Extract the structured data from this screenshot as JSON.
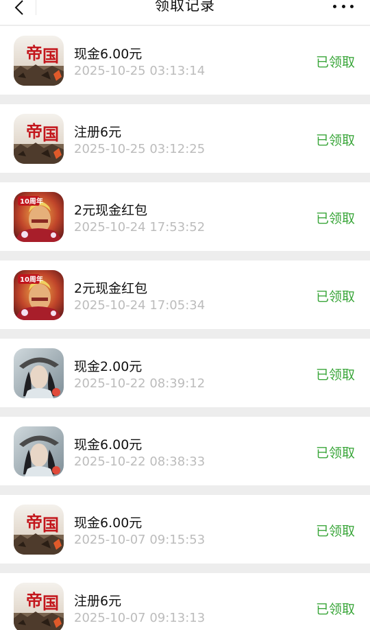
{
  "header": {
    "title": "领取记录"
  },
  "records": [
    {
      "icon": "empire-game-icon",
      "name": "现金6.00元",
      "time": "2025-10-25 03:13:14",
      "status": "已领取"
    },
    {
      "icon": "empire-game-icon",
      "name": "注册6元",
      "time": "2025-10-25 03:12:25",
      "status": "已领取"
    },
    {
      "icon": "hero-anniversary-game-icon",
      "name": "2元现金红包",
      "time": "2025-10-24 17:53:52",
      "status": "已领取"
    },
    {
      "icon": "hero-anniversary-game-icon",
      "name": "2元现金红包",
      "time": "2025-10-24 17:05:34",
      "status": "已领取"
    },
    {
      "icon": "wuxia-swordsman-game-icon",
      "name": "现金2.00元",
      "time": "2025-10-22 08:39:12",
      "status": "已领取"
    },
    {
      "icon": "wuxia-swordsman-game-icon",
      "name": "现金6.00元",
      "time": "2025-10-22 08:38:33",
      "status": "已领取"
    },
    {
      "icon": "empire-game-icon",
      "name": "现金6.00元",
      "time": "2025-10-07 09:15:53",
      "status": "已领取"
    },
    {
      "icon": "empire-game-icon",
      "name": "注册6元",
      "time": "2025-10-07 09:13:13",
      "status": "已领取"
    }
  ],
  "colors": {
    "status": "#3aa63a",
    "time": "#bcbcbc",
    "background": "#ededed"
  }
}
